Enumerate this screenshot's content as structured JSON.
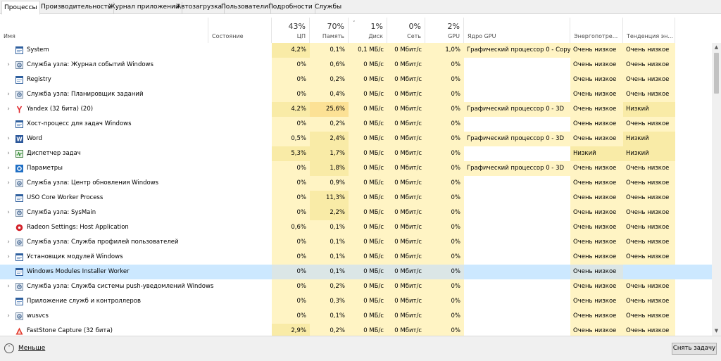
{
  "tabs": [
    "Процессы",
    "Производительность",
    "Журнал приложений",
    "Автозагрузка",
    "Пользователи",
    "Подробности",
    "Службы"
  ],
  "columns": {
    "name": "Имя",
    "status": "Состояние",
    "cpu": {
      "pct": "43%",
      "label": "ЦП"
    },
    "memory": {
      "pct": "70%",
      "label": "Память"
    },
    "disk": {
      "pct": "1%",
      "label": "Диск"
    },
    "network": {
      "pct": "0%",
      "label": "Сеть"
    },
    "gpu": {
      "pct": "2%",
      "label": "GPU"
    },
    "gpu_engine": "Ядро GPU",
    "power": "Энергопотре...",
    "power_trend": "Тенденция эн..."
  },
  "sort_indicator": "˅",
  "rows": [
    {
      "name": "System",
      "icon": "system-icon",
      "expandable": false,
      "cpu": "4,2%",
      "mem": "0,1%",
      "disk": "0,1 МБ/с",
      "net": "0 Мбит/с",
      "gpu": "1,0%",
      "engine": "Графический процессор 0 - Copy",
      "power": "Очень низкое",
      "trend": "Очень низкое"
    },
    {
      "name": "Служба узла: Журнал событий Windows",
      "icon": "service-gear-icon",
      "expandable": true,
      "cpu": "0%",
      "mem": "0,6%",
      "disk": "0 МБ/с",
      "net": "0 Мбит/с",
      "gpu": "0%",
      "engine": "",
      "power": "Очень низкое",
      "trend": "Очень низкое"
    },
    {
      "name": "Registry",
      "icon": "system-icon",
      "expandable": false,
      "cpu": "0%",
      "mem": "0,2%",
      "disk": "0 МБ/с",
      "net": "0 Мбит/с",
      "gpu": "0%",
      "engine": "",
      "power": "Очень низкое",
      "trend": "Очень низкое"
    },
    {
      "name": "Служба узла: Планировщик заданий",
      "icon": "service-gear-icon",
      "expandable": true,
      "cpu": "0%",
      "mem": "0,4%",
      "disk": "0 МБ/с",
      "net": "0 Мбит/с",
      "gpu": "0%",
      "engine": "",
      "power": "Очень низкое",
      "trend": "Очень низкое"
    },
    {
      "name": "Yandex (32 бита) (20)",
      "icon": "yandex-icon",
      "expandable": true,
      "cpu": "4,2%",
      "mem": "25,6%",
      "disk": "0 МБ/с",
      "net": "0 Мбит/с",
      "gpu": "0%",
      "engine": "Графический процессор 0 - 3D",
      "power": "Очень низкое",
      "trend": "Низкий"
    },
    {
      "name": "Хост-процесс для задач Windows",
      "icon": "system-icon",
      "expandable": false,
      "cpu": "0%",
      "mem": "0,2%",
      "disk": "0 МБ/с",
      "net": "0 Мбит/с",
      "gpu": "0%",
      "engine": "",
      "power": "Очень низкое",
      "trend": "Очень низкое"
    },
    {
      "name": "Word",
      "icon": "word-icon",
      "expandable": true,
      "cpu": "0,5%",
      "mem": "2,4%",
      "disk": "0 МБ/с",
      "net": "0 Мбит/с",
      "gpu": "0%",
      "engine": "Графический процессор 0 - 3D",
      "power": "Очень низкое",
      "trend": "Низкий"
    },
    {
      "name": "Диспетчер задач",
      "icon": "task-manager-icon",
      "expandable": true,
      "cpu": "5,3%",
      "mem": "1,7%",
      "disk": "0 МБ/с",
      "net": "0 Мбит/с",
      "gpu": "0%",
      "engine": "",
      "power": "Низкий",
      "trend": "Низкий"
    },
    {
      "name": "Параметры",
      "icon": "settings-gear-icon",
      "expandable": true,
      "cpu": "0%",
      "mem": "1,8%",
      "disk": "0 МБ/с",
      "net": "0 Мбит/с",
      "gpu": "0%",
      "engine": "Графический процессор 0 - 3D",
      "power": "Очень низкое",
      "trend": "Очень низкое"
    },
    {
      "name": "Служба узла: Центр обновления Windows",
      "icon": "service-gear-icon",
      "expandable": true,
      "cpu": "0%",
      "mem": "0,9%",
      "disk": "0 МБ/с",
      "net": "0 Мбит/с",
      "gpu": "0%",
      "engine": "",
      "power": "Очень низкое",
      "trend": "Очень низкое"
    },
    {
      "name": "USO Core Worker Process",
      "icon": "system-icon",
      "expandable": false,
      "cpu": "0%",
      "mem": "11,3%",
      "disk": "0 МБ/с",
      "net": "0 Мбит/с",
      "gpu": "0%",
      "engine": "",
      "power": "Очень низкое",
      "trend": "Очень низкое"
    },
    {
      "name": "Служба узла: SysMain",
      "icon": "service-gear-icon",
      "expandable": true,
      "cpu": "0%",
      "mem": "2,2%",
      "disk": "0 МБ/с",
      "net": "0 Мбит/с",
      "gpu": "0%",
      "engine": "",
      "power": "Очень низкое",
      "trend": "Очень низкое"
    },
    {
      "name": "Radeon Settings: Host Application",
      "icon": "radeon-icon",
      "expandable": false,
      "cpu": "0,6%",
      "mem": "0,1%",
      "disk": "0 МБ/с",
      "net": "0 Мбит/с",
      "gpu": "0%",
      "engine": "",
      "power": "Очень низкое",
      "trend": "Очень низкое"
    },
    {
      "name": "Служба узла: Служба профилей пользователей",
      "icon": "service-gear-icon",
      "expandable": true,
      "cpu": "0%",
      "mem": "0,1%",
      "disk": "0 МБ/с",
      "net": "0 Мбит/с",
      "gpu": "0%",
      "engine": "",
      "power": "Очень низкое",
      "trend": "Очень низкое"
    },
    {
      "name": "Установщик модулей Windows",
      "icon": "system-icon",
      "expandable": true,
      "cpu": "0%",
      "mem": "0,1%",
      "disk": "0 МБ/с",
      "net": "0 Мбит/с",
      "gpu": "0%",
      "engine": "",
      "power": "Очень низкое",
      "trend": "Очень низкое"
    },
    {
      "name": "Windows Modules Installer Worker",
      "icon": "system-icon",
      "expandable": false,
      "selected": true,
      "cpu": "0%",
      "mem": "0,1%",
      "disk": "0 МБ/с",
      "net": "0 Мбит/с",
      "gpu": "0%",
      "engine": "",
      "power": "Очень низкое",
      "trend": ""
    },
    {
      "name": "Служба узла: Служба системы push-уведомлений Windows",
      "icon": "service-gear-icon",
      "expandable": true,
      "cpu": "0%",
      "mem": "0,2%",
      "disk": "0 МБ/с",
      "net": "0 Мбит/с",
      "gpu": "0%",
      "engine": "",
      "power": "Очень низкое",
      "trend": "Очень низкое"
    },
    {
      "name": "Приложение служб и контроллеров",
      "icon": "system-icon",
      "expandable": false,
      "cpu": "0%",
      "mem": "0,3%",
      "disk": "0 МБ/с",
      "net": "0 Мбит/с",
      "gpu": "0%",
      "engine": "",
      "power": "Очень низкое",
      "trend": "Очень низкое"
    },
    {
      "name": "wusvcs",
      "icon": "service-gear-icon",
      "expandable": true,
      "cpu": "0%",
      "mem": "0,1%",
      "disk": "0 МБ/с",
      "net": "0 Мбит/с",
      "gpu": "0%",
      "engine": "",
      "power": "Очень низкое",
      "trend": "Очень низкое"
    },
    {
      "name": "FastStone Capture (32 бита)",
      "icon": "faststone-icon",
      "expandable": false,
      "cpu": "2,9%",
      "mem": "0,2%",
      "disk": "0 МБ/с",
      "net": "0 Мбит/с",
      "gpu": "0%",
      "engine": "",
      "power": "Очень низкое",
      "trend": "Очень низкое"
    }
  ],
  "footer": {
    "less_label": "Меньше",
    "end_task_label": "Снять задачу"
  }
}
